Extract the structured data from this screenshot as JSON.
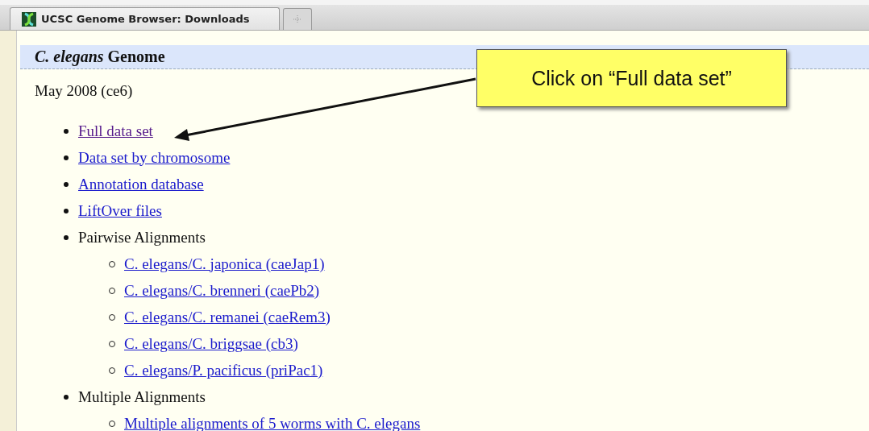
{
  "tabs": [
    {
      "label": "UCSC Genome Browser: Downloads",
      "selected": true
    }
  ],
  "page": {
    "heading_italic": "C. elegans",
    "heading_rest": "Genome",
    "subtitle": "May 2008 (ce6)",
    "items": [
      {
        "kind": "link",
        "label": "Full data set",
        "visited": true
      },
      {
        "kind": "link",
        "label": "Data set by chromosome",
        "visited": false
      },
      {
        "kind": "link",
        "label": "Annotation database",
        "visited": false
      },
      {
        "kind": "link",
        "label": "LiftOver files",
        "visited": false
      },
      {
        "kind": "text",
        "label": "Pairwise Alignments",
        "children": [
          {
            "kind": "link",
            "label": "C. elegans/C. japonica (caeJap1)",
            "visited": false
          },
          {
            "kind": "link",
            "label": "C. elegans/C. brenneri (caePb2)",
            "visited": false
          },
          {
            "kind": "link",
            "label": "C. elegans/C. remanei (caeRem3)",
            "visited": false
          },
          {
            "kind": "link",
            "label": "C. elegans/C. briggsae (cb3)",
            "visited": false
          },
          {
            "kind": "link",
            "label": "C. elegans/P. pacificus (priPac1)",
            "visited": false
          }
        ]
      },
      {
        "kind": "text",
        "label": "Multiple Alignments",
        "children": [
          {
            "kind": "link",
            "label": "Multiple alignments of 5 worms with C. elegans",
            "visited": false
          }
        ]
      }
    ]
  },
  "callout": {
    "text": "Click on “Full data set”"
  }
}
